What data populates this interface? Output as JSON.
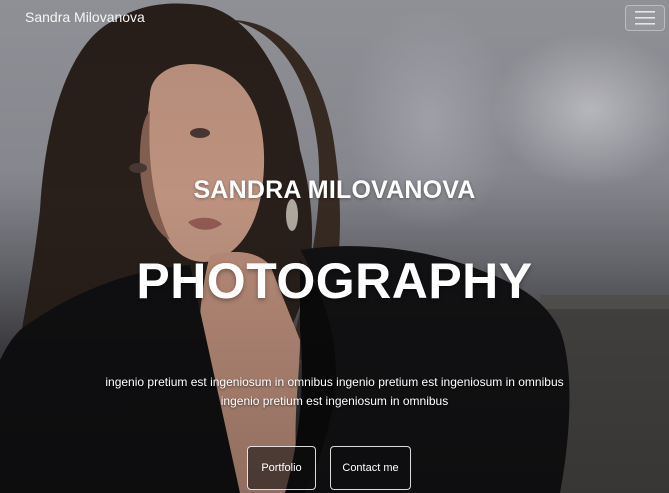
{
  "navbar": {
    "brand": "Sandra Milovanova",
    "menu_icon": "hamburger-menu-icon"
  },
  "hero": {
    "subtitle": "SANDRA MILOVANOVA",
    "headline": "PHOTOGRAPHY",
    "tagline_line1": "ingenio pretium est ingeniosum in omnibus ingenio pretium est ingeniosum in omnibus",
    "tagline_line2": "ingenio pretium est ingeniosum in omnibus",
    "buttons": {
      "portfolio": "Portfolio",
      "contact": "Contact me"
    }
  },
  "colors": {
    "text": "#ffffff",
    "button_border": "#ffffff",
    "button_bg": "#111113"
  }
}
